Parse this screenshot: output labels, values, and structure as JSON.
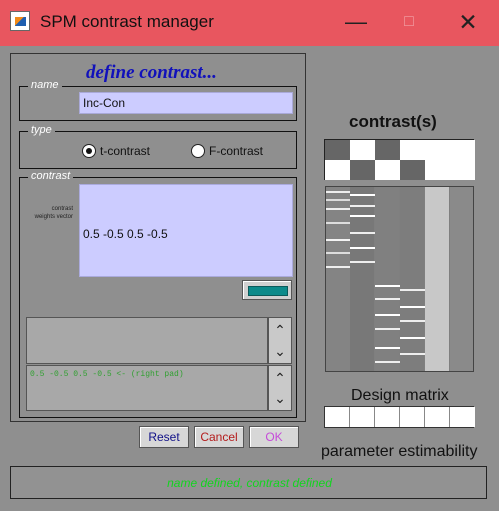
{
  "window": {
    "title": "SPM contrast manager",
    "controls": {
      "minimize": "—",
      "maximize": "□",
      "close": "✕"
    }
  },
  "form": {
    "heading": "define contrast...",
    "name_legend": "name",
    "name_value": "Inc-Con",
    "type_legend": "type",
    "type_options": [
      {
        "label": "t-contrast",
        "checked": true
      },
      {
        "label": "F-contrast",
        "checked": false
      }
    ],
    "contrast_legend": "contrast",
    "weights_label": "contrast weights vector",
    "weights_value": "0.5 -0.5 0.5 -0.5",
    "history_text": "0.5 -0.5 0.5 -0.5 <- (right pad)"
  },
  "buttons": {
    "reset": "Reset",
    "cancel": "Cancel",
    "ok": "OK"
  },
  "status": {
    "message": "name defined, contrast defined"
  },
  "right_panel": {
    "contrasts_title": "contrast(s)",
    "design_matrix_title": "Design matrix",
    "parameter_estimability_title": "parameter estimability"
  },
  "icons": {
    "window_icon": "spm-icon",
    "up_arrow": "⌃",
    "down_arrow": "⌄"
  },
  "colors": {
    "title_bar": "#e8565f",
    "field_fill": "#ccccff",
    "status_text": "#12d51f",
    "heading": "#1111bb"
  }
}
